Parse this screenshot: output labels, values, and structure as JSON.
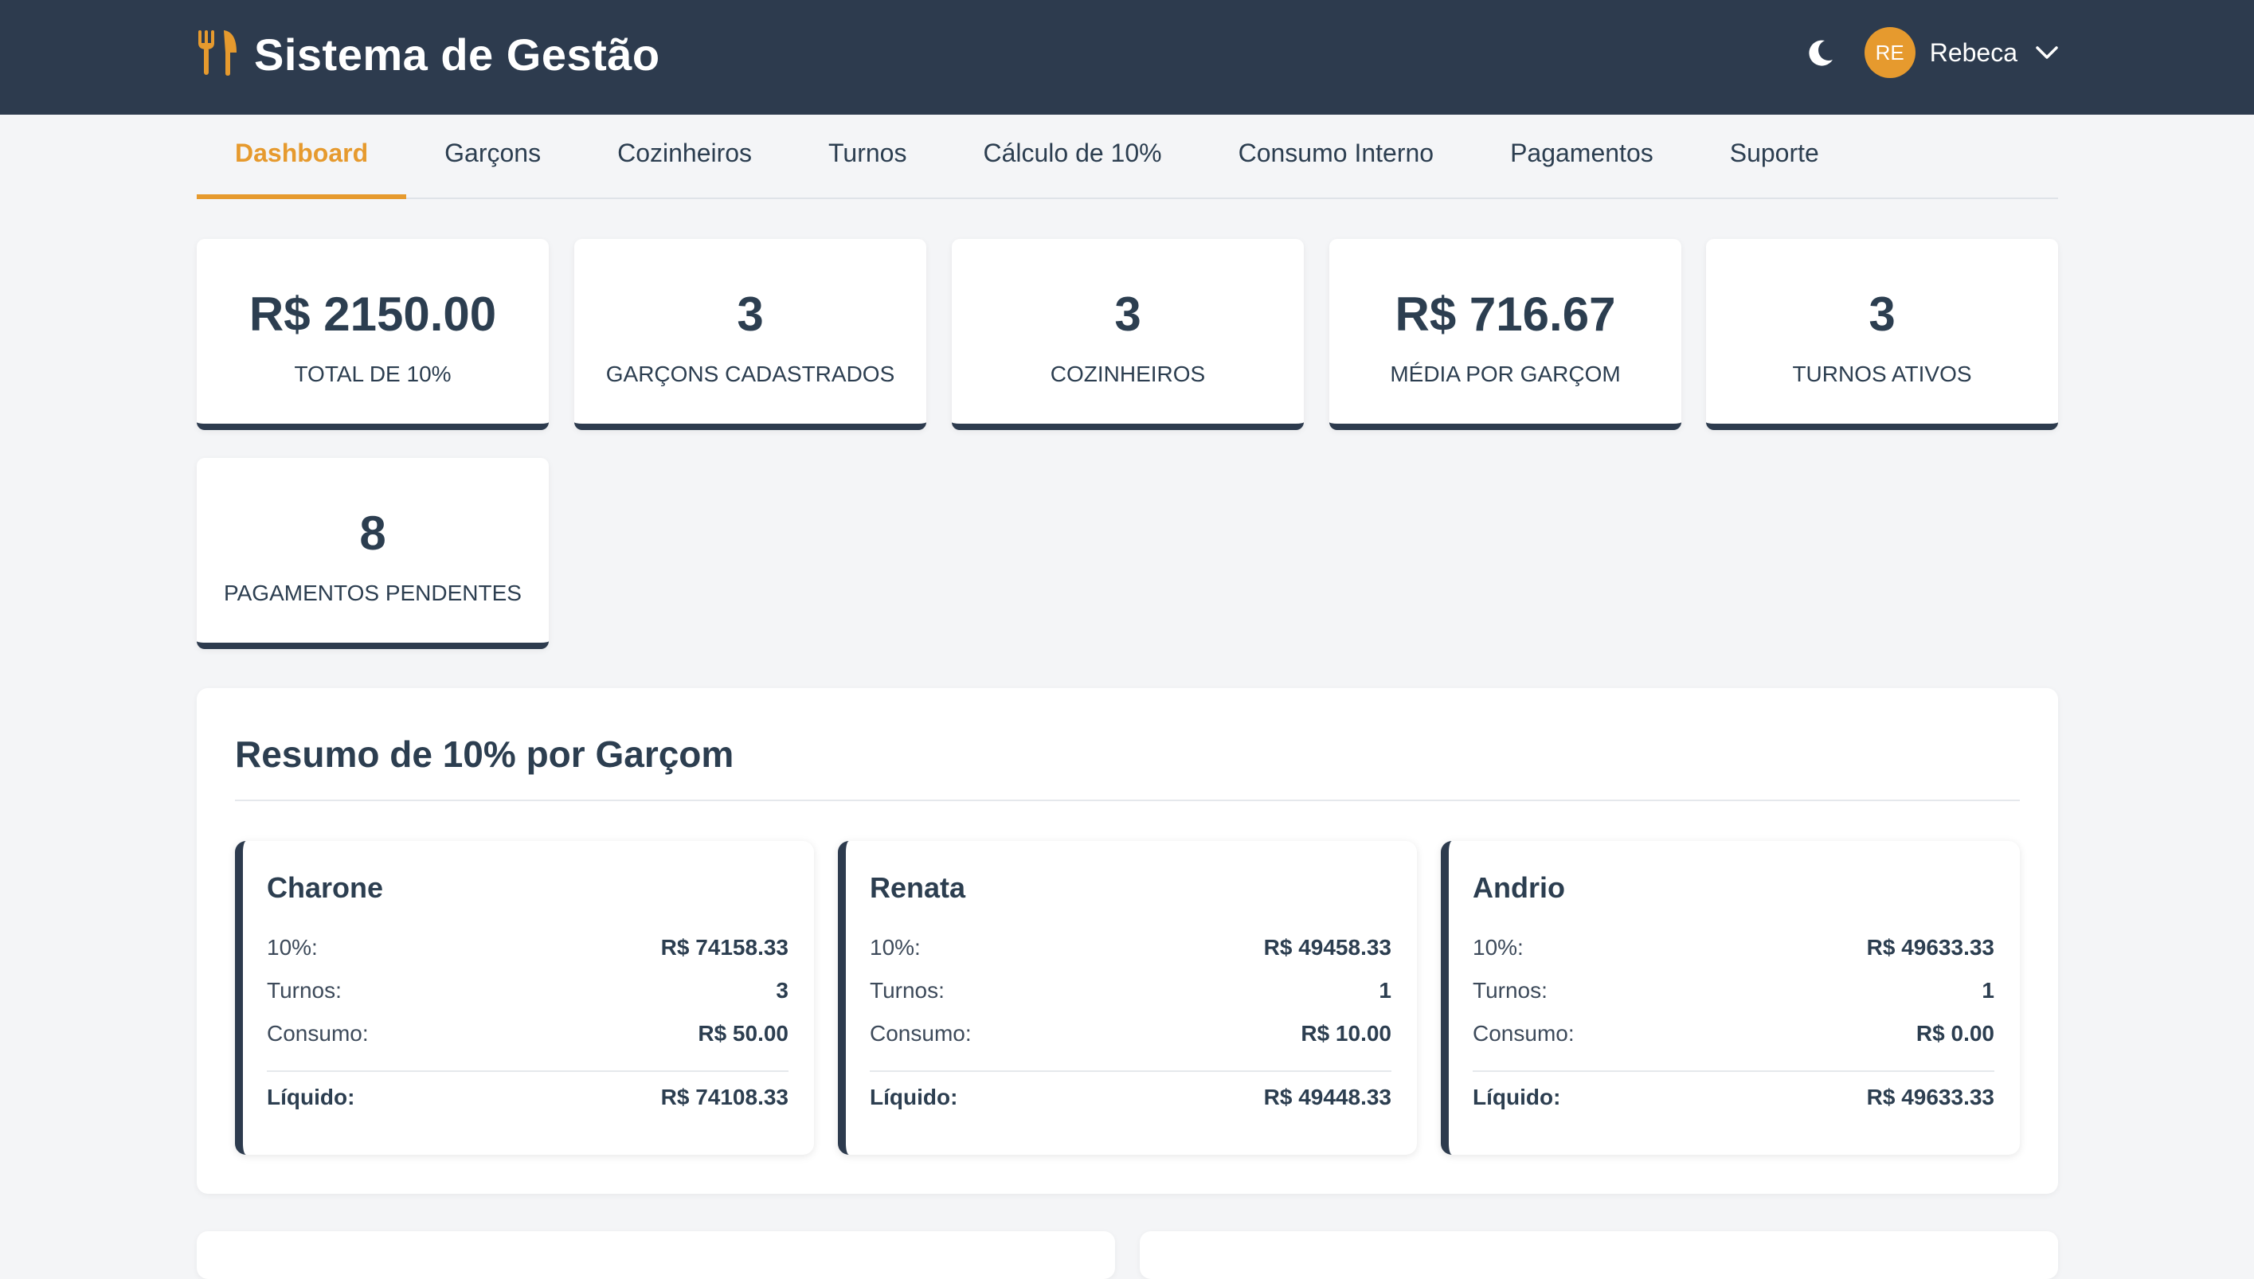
{
  "header": {
    "title": "Sistema de Gestão",
    "logo_icon": "utensils-icon",
    "theme_icon": "moon-icon",
    "user_initials": "RE",
    "user_name": "Rebeca",
    "accent": "#e69a2e",
    "bg": "#2d3b4e"
  },
  "tabs": [
    {
      "label": "Dashboard",
      "active": true
    },
    {
      "label": "Garçons"
    },
    {
      "label": "Cozinheiros"
    },
    {
      "label": "Turnos"
    },
    {
      "label": "Cálculo de 10%"
    },
    {
      "label": "Consumo Interno"
    },
    {
      "label": "Pagamentos"
    },
    {
      "label": "Suporte"
    }
  ],
  "stats": [
    {
      "value": "R$ 2150.00",
      "label": "TOTAL DE 10%"
    },
    {
      "value": "3",
      "label": "GARÇONS CADASTRADOS"
    },
    {
      "value": "3",
      "label": "COZINHEIROS"
    },
    {
      "value": "R$ 716.67",
      "label": "MÉDIA POR GARÇOM"
    },
    {
      "value": "3",
      "label": "TURNOS ATIVOS"
    },
    {
      "value": "8",
      "label": "PAGAMENTOS PENDENTES"
    }
  ],
  "summary": {
    "title": "Resumo de 10% por Garçom",
    "labels": {
      "pct": "10%:",
      "shifts": "Turnos:",
      "consumption": "Consumo:",
      "net": "Líquido:"
    },
    "waiters": [
      {
        "name": "Charone",
        "pct": "R$ 74158.33",
        "shifts": "3",
        "consumption": "R$ 50.00",
        "net": "R$ 74108.33"
      },
      {
        "name": "Renata",
        "pct": "R$ 49458.33",
        "shifts": "1",
        "consumption": "R$ 10.00",
        "net": "R$ 49448.33"
      },
      {
        "name": "Andrio",
        "pct": "R$ 49633.33",
        "shifts": "1",
        "consumption": "R$ 0.00",
        "net": "R$ 49633.33"
      }
    ]
  }
}
